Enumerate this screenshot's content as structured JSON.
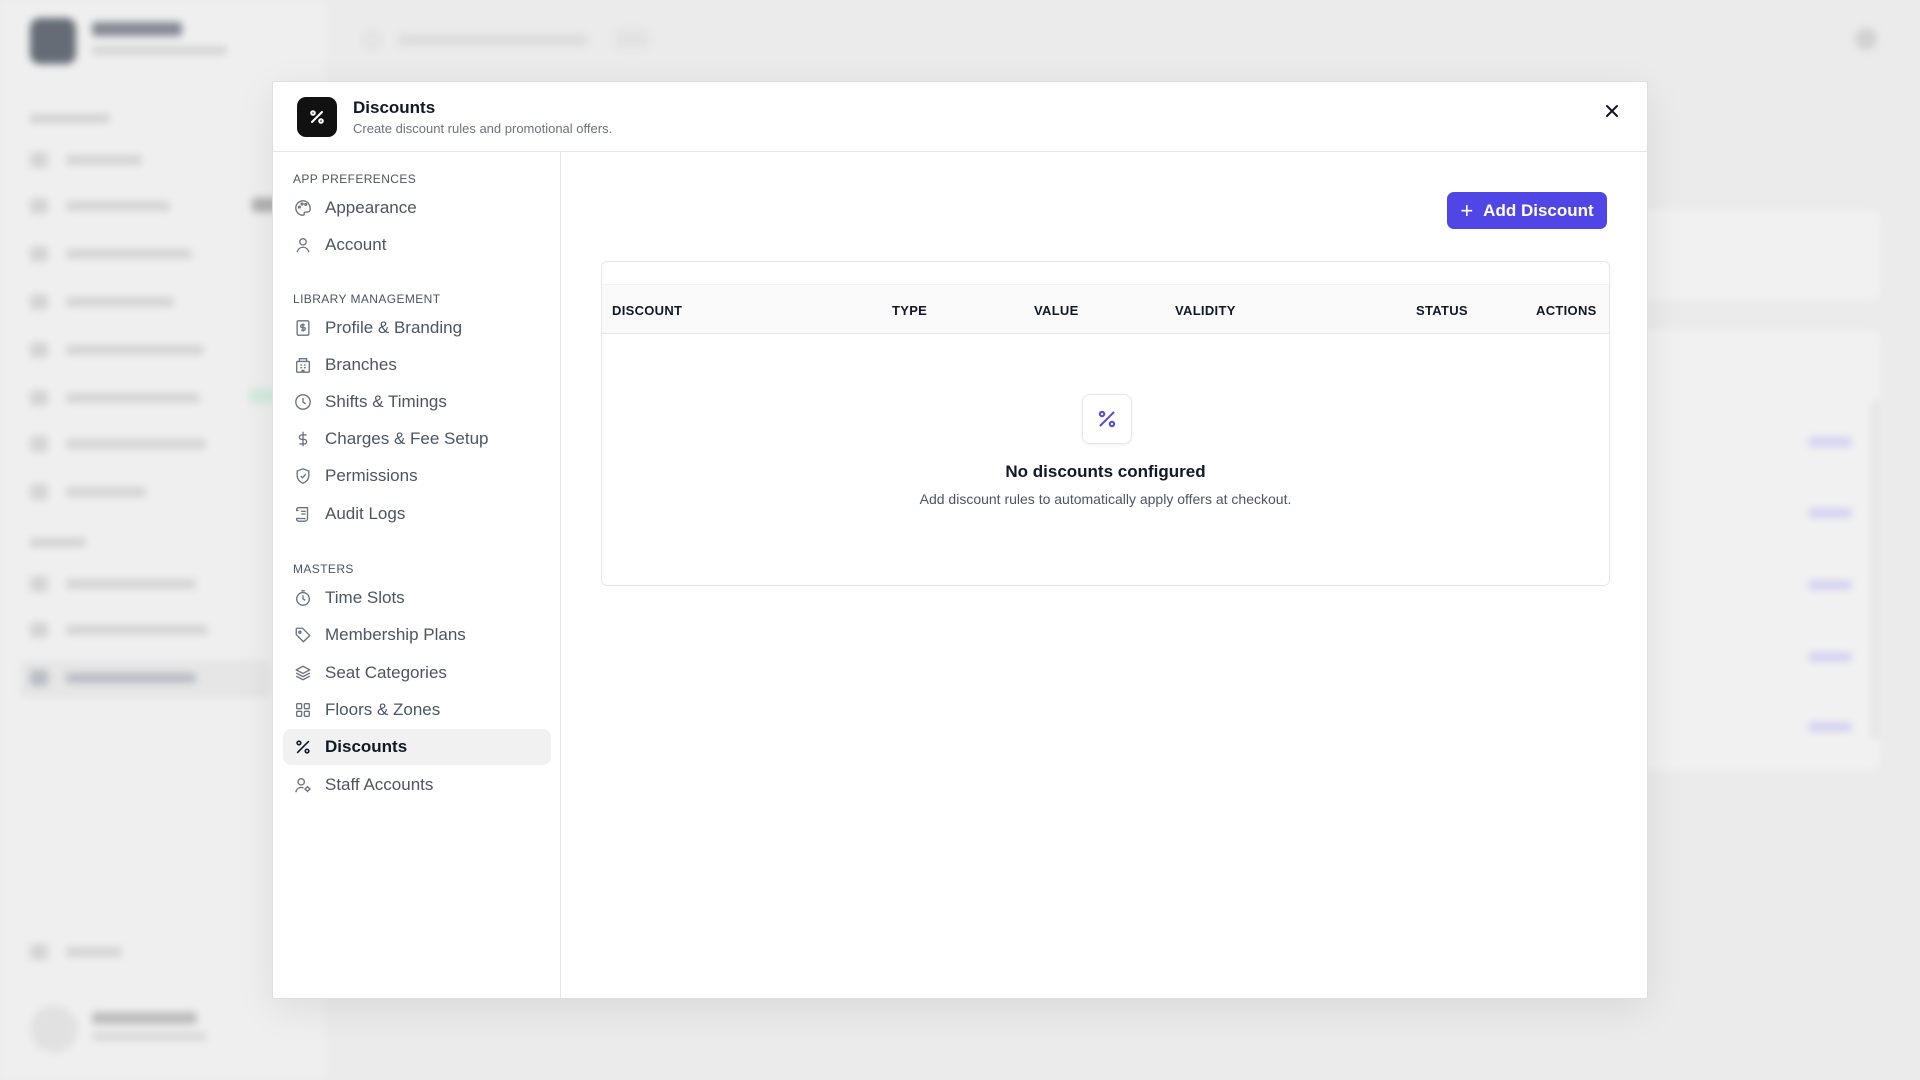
{
  "modal": {
    "title": "Discounts",
    "subtitle": "Create discount rules and promotional offers."
  },
  "nav": {
    "sections": [
      {
        "label": "APP PREFERENCES",
        "items": [
          {
            "label": "Appearance",
            "icon": "palette-icon"
          },
          {
            "label": "Account",
            "icon": "user-icon"
          }
        ]
      },
      {
        "label": "LIBRARY MANAGEMENT",
        "items": [
          {
            "label": "Profile & Branding",
            "icon": "document-dollar-icon"
          },
          {
            "label": "Branches",
            "icon": "building-icon"
          },
          {
            "label": "Shifts & Timings",
            "icon": "clock-icon"
          },
          {
            "label": "Charges & Fee Setup",
            "icon": "dollar-icon"
          },
          {
            "label": "Permissions",
            "icon": "shield-icon"
          },
          {
            "label": "Audit Logs",
            "icon": "scroll-icon"
          }
        ]
      },
      {
        "label": "MASTERS",
        "items": [
          {
            "label": "Time Slots",
            "icon": "timer-icon"
          },
          {
            "label": "Membership Plans",
            "icon": "tag-icon"
          },
          {
            "label": "Seat Categories",
            "icon": "layers-icon"
          },
          {
            "label": "Floors & Zones",
            "icon": "grid-icon"
          },
          {
            "label": "Discounts",
            "icon": "percent-icon",
            "active": true
          },
          {
            "label": "Staff Accounts",
            "icon": "user-gear-icon"
          }
        ]
      }
    ]
  },
  "content": {
    "add_button_label": "Add Discount",
    "table": {
      "columns": [
        "DISCOUNT",
        "TYPE",
        "VALUE",
        "VALIDITY",
        "STATUS",
        "ACTIONS"
      ],
      "rows": []
    },
    "empty_state": {
      "title": "No discounts configured",
      "message": "Add discount rules to automatically apply offers at checkout."
    }
  },
  "colors": {
    "accent": "#4f46e5",
    "header_icon_bg": "#111111",
    "active_nav_bg": "#f1f1f1"
  }
}
